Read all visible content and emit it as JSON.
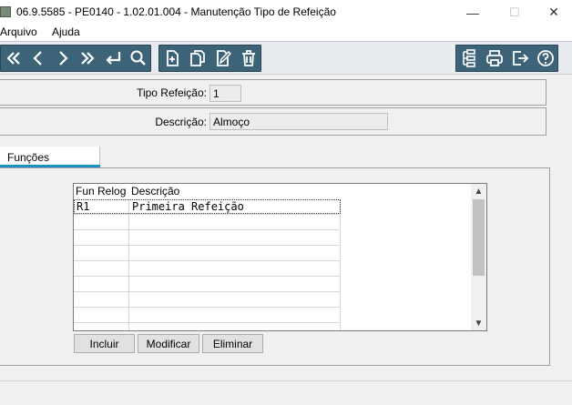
{
  "window": {
    "title": "06.9.5585 - PE0140 - 1.02.01.004 - Manutenção Tipo de Refeição",
    "minimize": "—",
    "maximize": "☐",
    "close": "✕"
  },
  "menu": {
    "items": [
      "Arquivo",
      "Ajuda"
    ]
  },
  "toolbar": {
    "nav_buttons": [
      "first-icon",
      "previous-icon",
      "next-icon",
      "last-icon",
      "return-icon",
      "search-icon"
    ],
    "edit_buttons": [
      "new-icon",
      "copy-icon",
      "edit-icon",
      "delete-icon"
    ],
    "util_buttons": [
      "structure-icon",
      "print-icon",
      "exit-icon",
      "help-icon"
    ],
    "accent": "#3c6378"
  },
  "form": {
    "tipo_label": "Tipo Refeição:",
    "tipo_value": "1",
    "descricao_label": "Descrição:",
    "descricao_value": "Almoço"
  },
  "tabs": [
    {
      "label": "Funções",
      "active": true
    }
  ],
  "grid": {
    "columns": [
      "Fun Relog",
      "Descrição"
    ],
    "rows": [
      [
        "R1",
        "Primeira Refeição"
      ]
    ],
    "scroll_up": "▲",
    "scroll_down": "▼"
  },
  "actions": {
    "incluir": "Incluir",
    "modificar": "Modificar",
    "eliminar": "Eliminar"
  }
}
